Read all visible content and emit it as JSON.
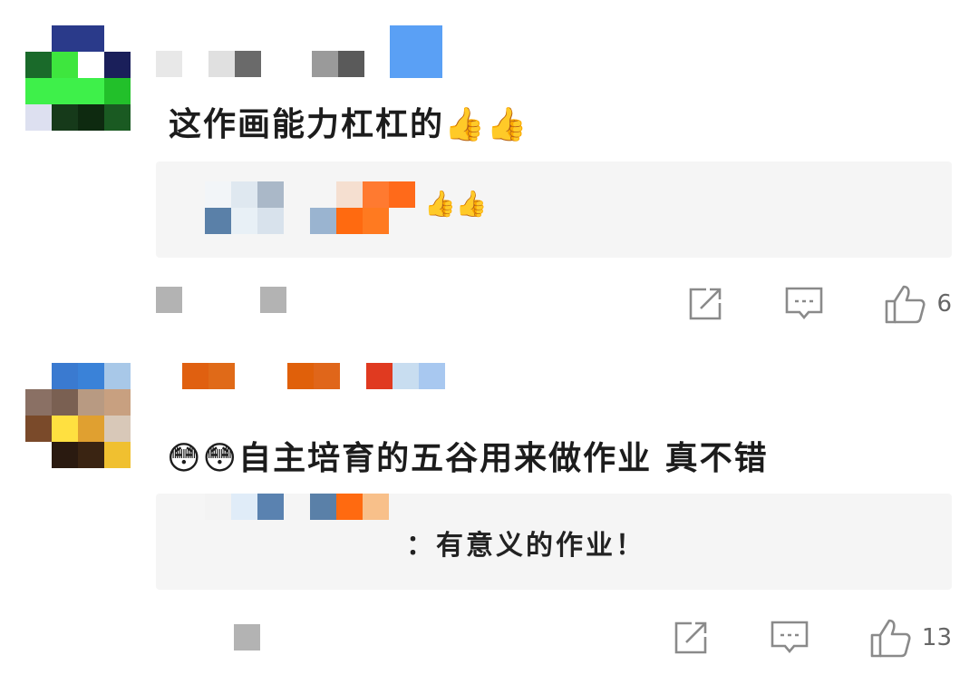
{
  "comments": [
    {
      "text": "这作画能力杠杠的",
      "emoji": "👍👍",
      "reply": {
        "prefix": "",
        "text": "",
        "emoji": "👍👍"
      },
      "like_count": "6",
      "icons": {
        "share": "share-icon",
        "reply": "comment-icon",
        "like": "thumbs-up-icon"
      }
    },
    {
      "emoji": "😳😳",
      "text": "自主培育的五谷用来做作业 真不错",
      "reply": {
        "prefix": "",
        "text": "：有意义的作业！",
        "emoji": ""
      },
      "like_count": "13",
      "icons": {
        "share": "share-icon",
        "reply": "comment-icon",
        "like": "thumbs-up-icon"
      }
    }
  ],
  "colors": {
    "reply_bg": "#f5f5f5",
    "meta_gray": "#b3b3b3",
    "icon_gray": "#8a8a8a"
  }
}
